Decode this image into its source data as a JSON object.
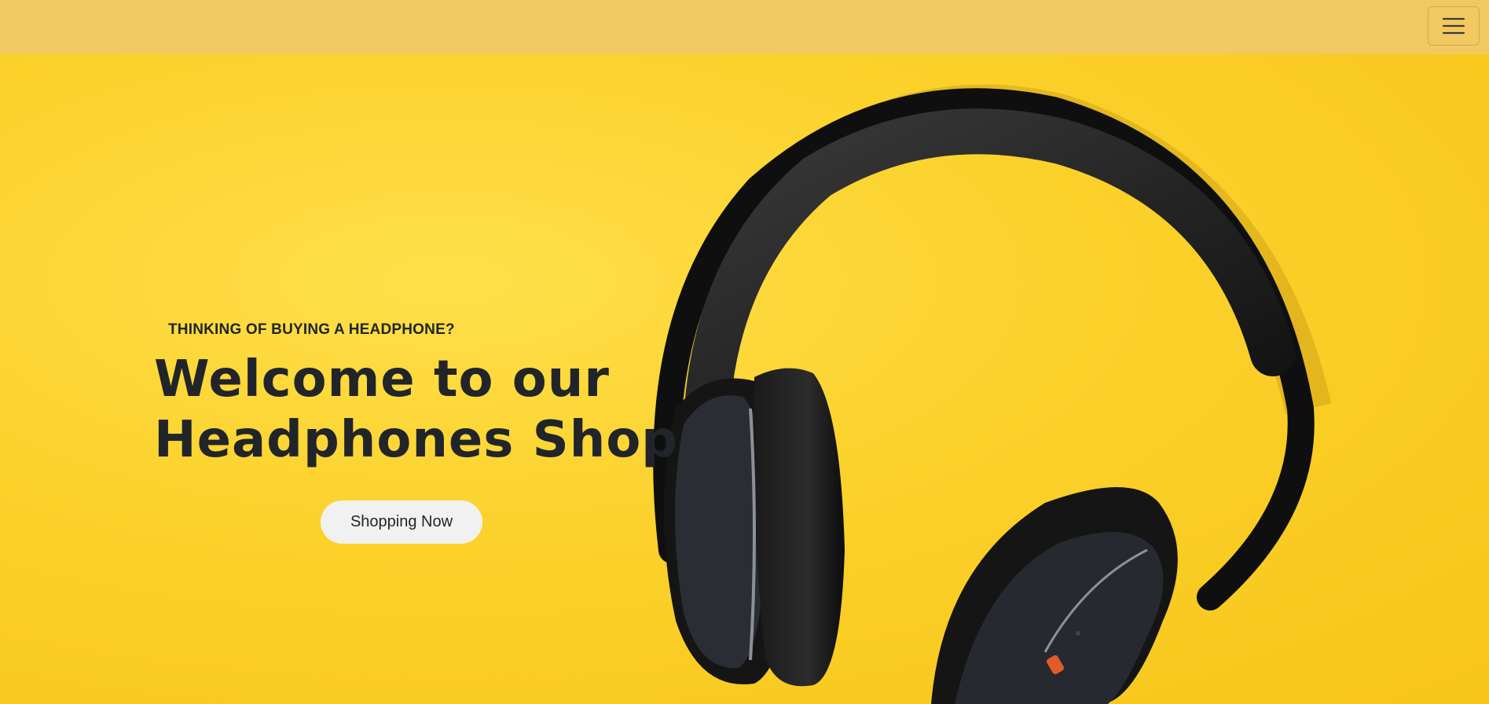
{
  "navbar": {
    "menu_icon": "hamburger-menu-icon"
  },
  "hero": {
    "eyebrow": "THINKING OF BUYING A HEADPHONE?",
    "title_line1": "Welcome to our",
    "title_line2": "Headphones Shop",
    "cta_label": "Shopping Now",
    "image_icon": "headphones-icon"
  },
  "colors": {
    "navbar_bg": "#f2c961",
    "background": "#fbd12a",
    "text": "#212529",
    "button_bg": "#f1f1f1"
  }
}
